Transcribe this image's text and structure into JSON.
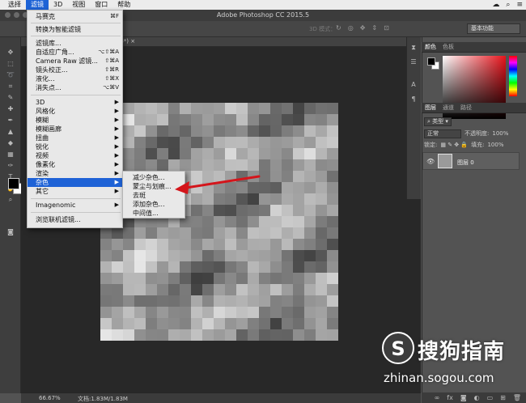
{
  "menubar": {
    "items": [
      "选择",
      "滤镜",
      "3D",
      "视图",
      "窗口",
      "帮助"
    ],
    "active_index": 1
  },
  "window_title": "Adobe Photoshop CC 2015.5",
  "options_bar": {
    "mode_3d": "3D 模式：",
    "workspace": "基本功能"
  },
  "document": {
    "tab_suffix": "/8*) ×",
    "zoom": "66.67%",
    "doc_info": "文档:1.83M/1.83M"
  },
  "filter_menu": {
    "items": [
      {
        "label": "马赛克",
        "shortcut": "⌘F"
      },
      {
        "label": "转换为智能滤镜",
        "shortcut": ""
      },
      {
        "label": "滤镜库...",
        "shortcut": ""
      },
      {
        "label": "自适应广角...",
        "shortcut": "⌥⇧⌘A"
      },
      {
        "label": "Camera Raw 滤镜...",
        "shortcut": "⇧⌘A"
      },
      {
        "label": "镜头校正...",
        "shortcut": "⇧⌘R"
      },
      {
        "label": "液化...",
        "shortcut": "⇧⌘X"
      },
      {
        "label": "消失点...",
        "shortcut": "⌥⌘V"
      },
      {
        "label": "3D",
        "shortcut": ""
      },
      {
        "label": "风格化",
        "shortcut": ""
      },
      {
        "label": "模糊",
        "shortcut": ""
      },
      {
        "label": "模糊画廊",
        "shortcut": ""
      },
      {
        "label": "扭曲",
        "shortcut": ""
      },
      {
        "label": "锐化",
        "shortcut": ""
      },
      {
        "label": "视频",
        "shortcut": ""
      },
      {
        "label": "像素化",
        "shortcut": ""
      },
      {
        "label": "渲染",
        "shortcut": ""
      },
      {
        "label": "杂色",
        "shortcut": ""
      },
      {
        "label": "其它",
        "shortcut": ""
      },
      {
        "label": "Imagenomic",
        "shortcut": ""
      },
      {
        "label": "浏览联机滤镜...",
        "shortcut": ""
      }
    ],
    "highlighted": "杂色"
  },
  "noise_submenu": {
    "items": [
      "减少杂色...",
      "蒙尘与划痕...",
      "去斑",
      "添加杂色...",
      "中间值..."
    ]
  },
  "color_panel": {
    "tabs": [
      "颜色",
      "色板"
    ]
  },
  "layers_panel": {
    "tabs": [
      "图层",
      "通道",
      "路径"
    ],
    "kind_filter": "类型",
    "blend_mode": "正常",
    "opacity_label": "不透明度:",
    "opacity_value": "100%",
    "lock_label": "锁定:",
    "fill_label": "填充:",
    "fill_value": "100%",
    "layer_name": "图层 0"
  },
  "watermark": {
    "brand": "搜狗指南",
    "url": "zhinan.sogou.com"
  },
  "colors": {
    "menu_highlight": "#1e62d6",
    "annotation_arrow": "#d4151b"
  }
}
